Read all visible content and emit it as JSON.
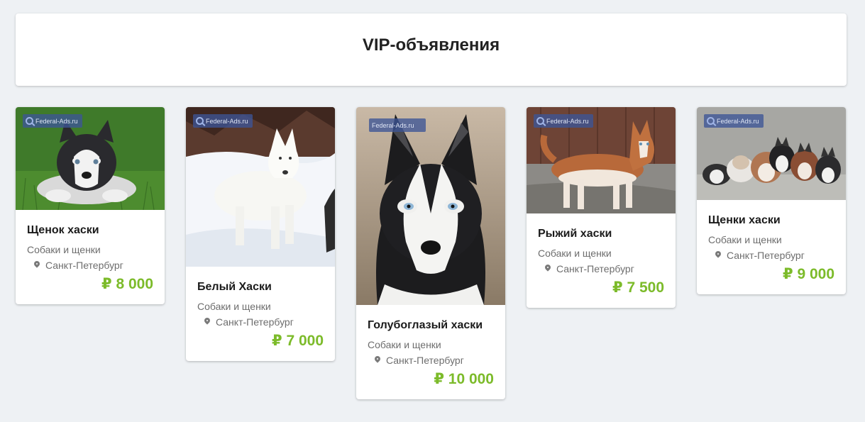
{
  "header": {
    "title": "VIP-объявления"
  },
  "watermark": "Federal-Ads.ru",
  "cards": [
    {
      "title": "Щенок хаски",
      "category": "Собаки и щенки",
      "location": "Санкт-Петербург",
      "price": "₽ 8 000",
      "image": "husky-puppy-grass"
    },
    {
      "title": "Белый Хаски",
      "category": "Собаки и щенки",
      "location": "Санкт-Петербург",
      "price": "₽ 7 000",
      "image": "white-husky-snow"
    },
    {
      "title": "Голубоглазый хаски",
      "category": "Собаки и щенки",
      "location": "Санкт-Петербург",
      "price": "₽ 10 000",
      "image": "blue-eyed-husky-portrait"
    },
    {
      "title": "Рыжий хаски",
      "category": "Собаки и щенки",
      "location": "Санкт-Петербург",
      "price": "₽ 7 500",
      "image": "red-husky-standing"
    },
    {
      "title": "Щенки хаски",
      "category": "Собаки и щенки",
      "location": "Санкт-Петербург",
      "price": "₽ 9 000",
      "image": "husky-puppies-group"
    }
  ],
  "colors": {
    "price": "#7cbb2a",
    "background": "#eef1f4"
  }
}
